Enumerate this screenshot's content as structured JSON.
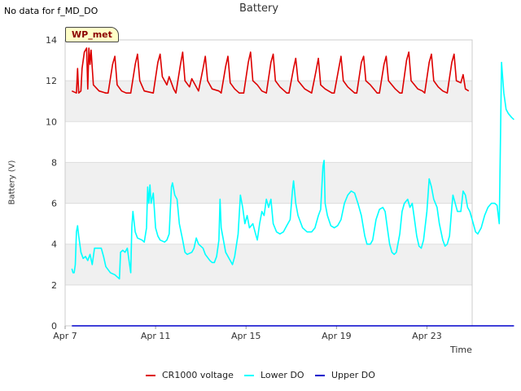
{
  "page": {
    "no_data_note": "No data for f_MD_DO",
    "site_badge": "WP_met"
  },
  "chart_data": {
    "type": "line",
    "title": "Battery",
    "xlabel": "Time",
    "ylabel": "Battery (V)",
    "ylim": [
      0,
      14
    ],
    "y_ticks": [
      0,
      2,
      4,
      6,
      8,
      10,
      12,
      14
    ],
    "x_range_days": [
      "Apr 7",
      "Apr 25"
    ],
    "x_ticks": [
      {
        "label": "Apr 7",
        "day": 7
      },
      {
        "label": "Apr 11",
        "day": 11
      },
      {
        "label": "Apr 15",
        "day": 15
      },
      {
        "label": "Apr 19",
        "day": 19
      },
      {
        "label": "Apr 23",
        "day": 23
      }
    ],
    "grid": "alternating horizontal bands",
    "legend_position": "bottom",
    "series": [
      {
        "name": "CR1000 voltage",
        "color": "#dd0000",
        "points": [
          [
            7.3,
            11.5
          ],
          [
            7.5,
            11.4
          ],
          [
            7.55,
            12.6
          ],
          [
            7.6,
            11.4
          ],
          [
            7.7,
            11.5
          ],
          [
            7.75,
            12.6
          ],
          [
            7.85,
            13.4
          ],
          [
            7.95,
            13.6
          ],
          [
            8.0,
            11.6
          ],
          [
            8.05,
            13.6
          ],
          [
            8.1,
            12.8
          ],
          [
            8.15,
            13.5
          ],
          [
            8.25,
            11.8
          ],
          [
            8.5,
            11.5
          ],
          [
            8.8,
            11.4
          ],
          [
            8.9,
            11.4
          ],
          [
            9.1,
            12.8
          ],
          [
            9.2,
            13.2
          ],
          [
            9.3,
            11.8
          ],
          [
            9.5,
            11.5
          ],
          [
            9.7,
            11.4
          ],
          [
            9.9,
            11.4
          ],
          [
            10.1,
            12.8
          ],
          [
            10.2,
            13.3
          ],
          [
            10.3,
            12.0
          ],
          [
            10.5,
            11.5
          ],
          [
            10.9,
            11.4
          ],
          [
            11.1,
            12.9
          ],
          [
            11.2,
            13.3
          ],
          [
            11.3,
            12.2
          ],
          [
            11.5,
            11.8
          ],
          [
            11.6,
            12.2
          ],
          [
            11.8,
            11.6
          ],
          [
            11.9,
            11.4
          ],
          [
            12.1,
            12.8
          ],
          [
            12.2,
            13.4
          ],
          [
            12.3,
            12.0
          ],
          [
            12.5,
            11.7
          ],
          [
            12.6,
            12.1
          ],
          [
            12.9,
            11.5
          ],
          [
            13.1,
            12.6
          ],
          [
            13.2,
            13.2
          ],
          [
            13.3,
            12.0
          ],
          [
            13.5,
            11.6
          ],
          [
            13.8,
            11.5
          ],
          [
            13.9,
            11.4
          ],
          [
            14.1,
            12.7
          ],
          [
            14.2,
            13.2
          ],
          [
            14.3,
            11.9
          ],
          [
            14.5,
            11.6
          ],
          [
            14.7,
            11.4
          ],
          [
            14.9,
            11.4
          ],
          [
            15.1,
            12.9
          ],
          [
            15.2,
            13.4
          ],
          [
            15.3,
            12.0
          ],
          [
            15.5,
            11.8
          ],
          [
            15.7,
            11.5
          ],
          [
            15.9,
            11.4
          ],
          [
            16.1,
            12.9
          ],
          [
            16.2,
            13.3
          ],
          [
            16.3,
            12.0
          ],
          [
            16.5,
            11.7
          ],
          [
            16.8,
            11.4
          ],
          [
            16.9,
            11.4
          ],
          [
            17.1,
            12.6
          ],
          [
            17.2,
            13.1
          ],
          [
            17.3,
            12.0
          ],
          [
            17.6,
            11.6
          ],
          [
            17.9,
            11.4
          ],
          [
            18.1,
            12.5
          ],
          [
            18.2,
            13.1
          ],
          [
            18.3,
            11.8
          ],
          [
            18.5,
            11.6
          ],
          [
            18.8,
            11.4
          ],
          [
            18.9,
            11.4
          ],
          [
            19.1,
            12.6
          ],
          [
            19.2,
            13.2
          ],
          [
            19.3,
            12.0
          ],
          [
            19.5,
            11.7
          ],
          [
            19.8,
            11.4
          ],
          [
            19.9,
            11.4
          ],
          [
            20.1,
            12.9
          ],
          [
            20.2,
            13.2
          ],
          [
            20.3,
            12.0
          ],
          [
            20.5,
            11.8
          ],
          [
            20.8,
            11.4
          ],
          [
            20.9,
            11.4
          ],
          [
            21.1,
            12.8
          ],
          [
            21.2,
            13.2
          ],
          [
            21.3,
            12.0
          ],
          [
            21.6,
            11.6
          ],
          [
            21.8,
            11.4
          ],
          [
            21.9,
            11.4
          ],
          [
            22.1,
            13.0
          ],
          [
            22.2,
            13.4
          ],
          [
            22.3,
            12.0
          ],
          [
            22.6,
            11.6
          ],
          [
            22.8,
            11.5
          ],
          [
            22.9,
            11.4
          ],
          [
            23.1,
            12.9
          ],
          [
            23.2,
            13.3
          ],
          [
            23.3,
            12.0
          ],
          [
            23.5,
            11.7
          ],
          [
            23.7,
            11.5
          ],
          [
            23.9,
            11.4
          ],
          [
            24.1,
            12.9
          ],
          [
            24.2,
            13.3
          ],
          [
            24.3,
            12.0
          ],
          [
            24.5,
            11.9
          ],
          [
            24.6,
            12.3
          ],
          [
            24.7,
            11.6
          ],
          [
            24.85,
            11.5
          ]
        ]
      },
      {
        "name": "Lower DO",
        "color": "#00ffff",
        "points": [
          [
            7.3,
            2.8
          ],
          [
            7.35,
            2.6
          ],
          [
            7.4,
            2.6
          ],
          [
            7.45,
            3.0
          ],
          [
            7.5,
            4.6
          ],
          [
            7.55,
            4.9
          ],
          [
            7.6,
            4.4
          ],
          [
            7.7,
            3.6
          ],
          [
            7.8,
            3.3
          ],
          [
            7.9,
            3.4
          ],
          [
            8.0,
            3.2
          ],
          [
            8.1,
            3.5
          ],
          [
            8.2,
            3.0
          ],
          [
            8.3,
            3.8
          ],
          [
            8.4,
            3.8
          ],
          [
            8.6,
            3.8
          ],
          [
            8.7,
            3.4
          ],
          [
            8.8,
            2.9
          ],
          [
            9.0,
            2.6
          ],
          [
            9.2,
            2.5
          ],
          [
            9.3,
            2.4
          ],
          [
            9.4,
            2.3
          ],
          [
            9.45,
            3.6
          ],
          [
            9.55,
            3.7
          ],
          [
            9.65,
            3.6
          ],
          [
            9.75,
            3.8
          ],
          [
            9.8,
            3.4
          ],
          [
            9.85,
            3.0
          ],
          [
            9.9,
            2.6
          ],
          [
            9.95,
            4.8
          ],
          [
            10.0,
            5.6
          ],
          [
            10.1,
            4.6
          ],
          [
            10.2,
            4.3
          ],
          [
            10.4,
            4.2
          ],
          [
            10.5,
            4.1
          ],
          [
            10.6,
            4.8
          ],
          [
            10.65,
            6.8
          ],
          [
            10.7,
            6.0
          ],
          [
            10.75,
            6.9
          ],
          [
            10.8,
            6.0
          ],
          [
            10.9,
            6.5
          ],
          [
            11.0,
            4.8
          ],
          [
            11.1,
            4.4
          ],
          [
            11.2,
            4.2
          ],
          [
            11.4,
            4.1
          ],
          [
            11.5,
            4.2
          ],
          [
            11.6,
            4.5
          ],
          [
            11.7,
            6.8
          ],
          [
            11.75,
            7.0
          ],
          [
            11.85,
            6.4
          ],
          [
            11.95,
            6.2
          ],
          [
            12.05,
            5.0
          ],
          [
            12.2,
            4.2
          ],
          [
            12.3,
            3.6
          ],
          [
            12.4,
            3.5
          ],
          [
            12.6,
            3.6
          ],
          [
            12.7,
            3.8
          ],
          [
            12.8,
            4.3
          ],
          [
            12.9,
            4.0
          ],
          [
            13.1,
            3.8
          ],
          [
            13.2,
            3.5
          ],
          [
            13.4,
            3.2
          ],
          [
            13.5,
            3.1
          ],
          [
            13.6,
            3.1
          ],
          [
            13.7,
            3.4
          ],
          [
            13.8,
            4.2
          ],
          [
            13.85,
            6.2
          ],
          [
            13.9,
            4.8
          ],
          [
            14.1,
            3.6
          ],
          [
            14.3,
            3.2
          ],
          [
            14.4,
            3.0
          ],
          [
            14.5,
            3.4
          ],
          [
            14.65,
            4.5
          ],
          [
            14.75,
            6.4
          ],
          [
            14.85,
            5.8
          ],
          [
            14.95,
            5.0
          ],
          [
            15.05,
            5.4
          ],
          [
            15.15,
            4.8
          ],
          [
            15.3,
            5.0
          ],
          [
            15.4,
            4.6
          ],
          [
            15.5,
            4.2
          ],
          [
            15.6,
            5.0
          ],
          [
            15.7,
            5.6
          ],
          [
            15.8,
            5.4
          ],
          [
            15.9,
            6.2
          ],
          [
            16.0,
            5.8
          ],
          [
            16.1,
            6.2
          ],
          [
            16.2,
            5.0
          ],
          [
            16.35,
            4.6
          ],
          [
            16.5,
            4.5
          ],
          [
            16.65,
            4.6
          ],
          [
            16.8,
            4.9
          ],
          [
            16.95,
            5.2
          ],
          [
            17.05,
            6.6
          ],
          [
            17.1,
            7.1
          ],
          [
            17.2,
            6.0
          ],
          [
            17.3,
            5.4
          ],
          [
            17.5,
            4.8
          ],
          [
            17.7,
            4.6
          ],
          [
            17.9,
            4.6
          ],
          [
            18.05,
            4.8
          ],
          [
            18.2,
            5.4
          ],
          [
            18.3,
            5.7
          ],
          [
            18.4,
            7.8
          ],
          [
            18.45,
            8.1
          ],
          [
            18.5,
            6.0
          ],
          [
            18.6,
            5.4
          ],
          [
            18.75,
            4.9
          ],
          [
            18.9,
            4.8
          ],
          [
            19.05,
            4.9
          ],
          [
            19.2,
            5.2
          ],
          [
            19.35,
            6.0
          ],
          [
            19.5,
            6.4
          ],
          [
            19.65,
            6.6
          ],
          [
            19.8,
            6.5
          ],
          [
            19.95,
            6.0
          ],
          [
            20.1,
            5.4
          ],
          [
            20.25,
            4.4
          ],
          [
            20.35,
            4.0
          ],
          [
            20.5,
            4.0
          ],
          [
            20.6,
            4.2
          ],
          [
            20.75,
            5.2
          ],
          [
            20.9,
            5.7
          ],
          [
            21.05,
            5.8
          ],
          [
            21.15,
            5.6
          ],
          [
            21.25,
            4.8
          ],
          [
            21.35,
            4.0
          ],
          [
            21.45,
            3.6
          ],
          [
            21.55,
            3.5
          ],
          [
            21.65,
            3.6
          ],
          [
            21.8,
            4.5
          ],
          [
            21.9,
            5.6
          ],
          [
            22.0,
            6.0
          ],
          [
            22.15,
            6.2
          ],
          [
            22.25,
            5.8
          ],
          [
            22.35,
            6.0
          ],
          [
            22.45,
            5.2
          ],
          [
            22.55,
            4.4
          ],
          [
            22.65,
            3.9
          ],
          [
            22.75,
            3.8
          ],
          [
            22.85,
            4.2
          ],
          [
            23.0,
            5.6
          ],
          [
            23.1,
            7.2
          ],
          [
            23.2,
            6.8
          ],
          [
            23.3,
            6.2
          ],
          [
            23.45,
            5.8
          ],
          [
            23.55,
            5.0
          ],
          [
            23.7,
            4.2
          ],
          [
            23.8,
            3.9
          ],
          [
            23.9,
            4.0
          ],
          [
            24.0,
            4.4
          ],
          [
            24.1,
            5.8
          ],
          [
            24.15,
            6.4
          ],
          [
            24.25,
            6.0
          ],
          [
            24.35,
            5.6
          ],
          [
            24.5,
            5.6
          ],
          [
            24.6,
            6.6
          ],
          [
            24.7,
            6.4
          ],
          [
            24.8,
            5.8
          ],
          [
            24.9,
            5.6
          ],
          [
            25.05,
            5.0
          ],
          [
            25.15,
            4.6
          ],
          [
            25.25,
            4.5
          ],
          [
            25.4,
            4.8
          ],
          [
            25.55,
            5.4
          ],
          [
            25.7,
            5.8
          ],
          [
            25.85,
            6.0
          ],
          [
            26.0,
            6.0
          ],
          [
            26.1,
            5.9
          ],
          [
            26.2,
            5.0
          ],
          [
            26.3,
            12.9
          ],
          [
            26.4,
            11.4
          ],
          [
            26.5,
            10.6
          ],
          [
            26.6,
            10.4
          ],
          [
            26.75,
            10.2
          ],
          [
            26.85,
            10.1
          ]
        ]
      },
      {
        "name": "Upper DO",
        "color": "#0000cc",
        "points": [
          [
            7.3,
            0.0
          ],
          [
            26.85,
            0.0
          ]
        ]
      }
    ]
  },
  "legend": {
    "items": [
      {
        "label": "CR1000 voltage",
        "color": "#dd0000"
      },
      {
        "label": "Lower DO",
        "color": "#00ffff"
      },
      {
        "label": "Upper DO",
        "color": "#0000cc"
      }
    ]
  }
}
